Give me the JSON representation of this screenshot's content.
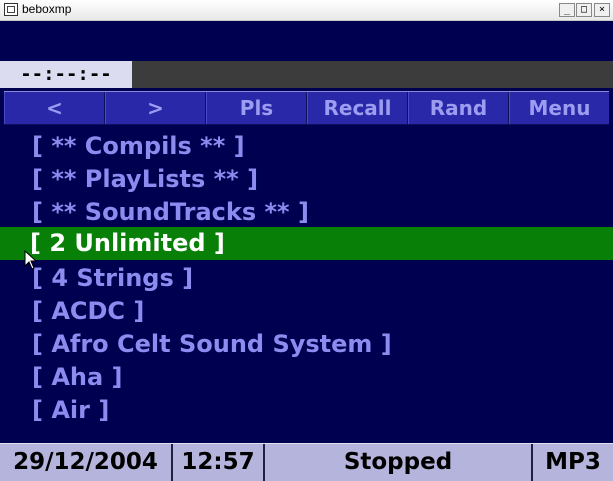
{
  "window": {
    "title": "beboxmp",
    "min_glyph": "_",
    "max_glyph": "□",
    "close_glyph": "×"
  },
  "player": {
    "time": "--:--:--"
  },
  "toolbar": {
    "prev_label": "<",
    "next_label": ">",
    "pls_label": "Pls",
    "recall_label": "Recall",
    "rand_label": "Rand",
    "menu_label": "Menu"
  },
  "list": {
    "items": [
      "[ ** Compils ** ]",
      "[ ** PlayLists ** ]",
      "[ ** SoundTracks ** ]",
      "[ 2 Unlimited ]",
      "[ 4 Strings ]",
      "[ ACDC ]",
      "[ Afro Celt Sound System ]",
      "[ Aha ]",
      "[ Air ]"
    ],
    "selected_index": 3
  },
  "status": {
    "date": "29/12/2004",
    "clock": "12:57",
    "state": "Stopped",
    "format": "MP3"
  },
  "colors": {
    "background": "#000050",
    "item_text": "#8c8cf0",
    "selected_bg": "#088008",
    "toolbar_bg": "#2828a8",
    "status_bg": "#b4b4dc"
  }
}
